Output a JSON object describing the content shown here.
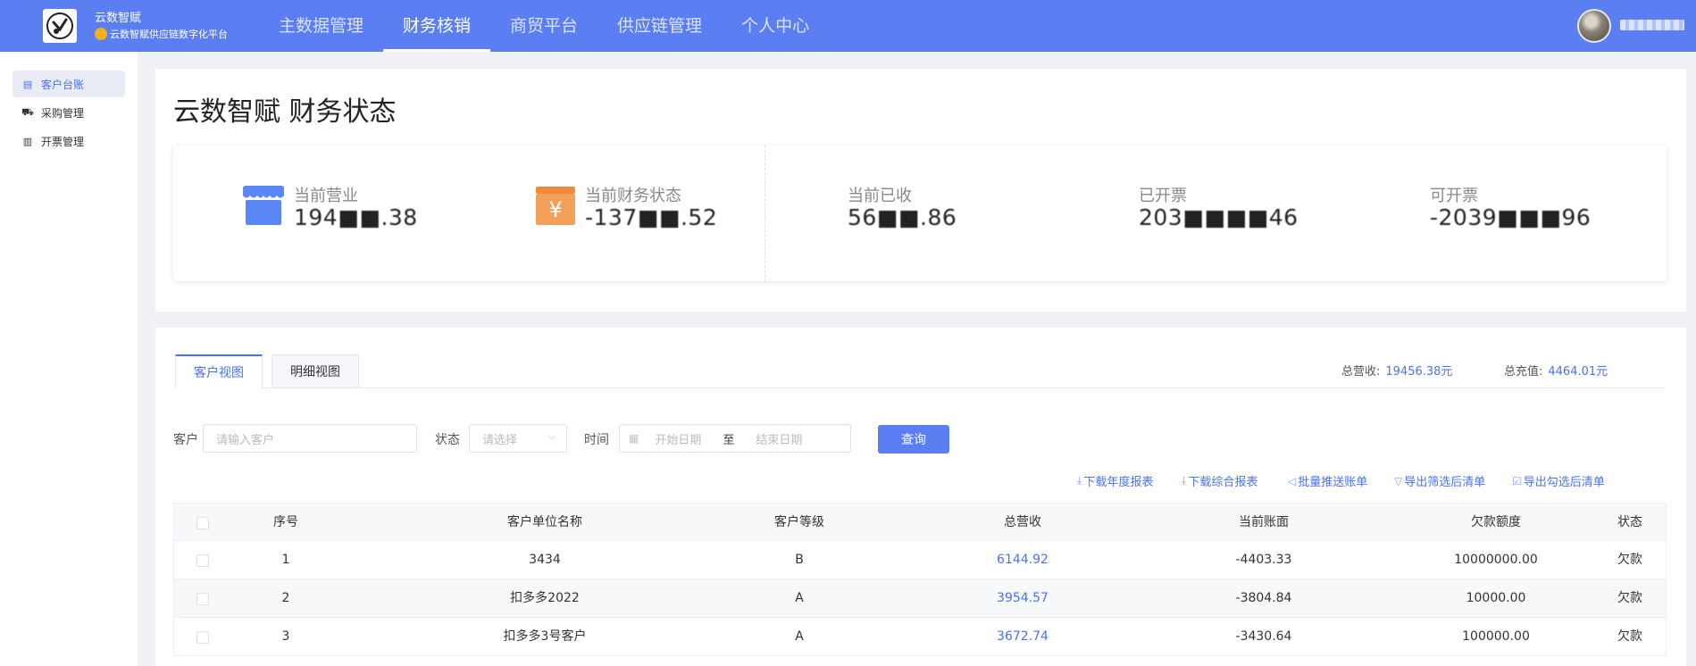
{
  "brand": {
    "title": "云数智赋",
    "subtitle": "云数智赋供应链数字化平台"
  },
  "nav": {
    "items": [
      {
        "label": "主数据管理"
      },
      {
        "label": "财务核销"
      },
      {
        "label": "商贸平台"
      },
      {
        "label": "供应链管理"
      },
      {
        "label": "个人中心"
      }
    ],
    "active_index": 1
  },
  "sidebar": {
    "items": [
      {
        "label": "客户台账",
        "icon": "ledger-icon"
      },
      {
        "label": "采购管理",
        "icon": "cart-icon"
      },
      {
        "label": "开票管理",
        "icon": "document-icon"
      }
    ],
    "active_index": 0
  },
  "page": {
    "title": "云数智赋 财务状态"
  },
  "stats": {
    "current_revenue": {
      "label": "当前营业",
      "value": "194■■.38",
      "icon": "store-icon"
    },
    "current_finance": {
      "label": "当前财务状态",
      "value": "-137■■.52",
      "icon": "yen-icon"
    },
    "received": {
      "label": "当前已收",
      "value": "56■■.86"
    },
    "invoiced": {
      "label": "已开票",
      "value": "203■■■■46"
    },
    "invoiceable": {
      "label": "可开票",
      "value": "-2039■■■96"
    }
  },
  "tabs": {
    "customer_view": "客户视图",
    "detail_view": "明细视图"
  },
  "totals": {
    "revenue_label": "总营收:",
    "revenue_value": "19456.38元",
    "recharge_label": "总充值:",
    "recharge_value": "4464.01元"
  },
  "filters": {
    "customer_label": "客户",
    "customer_placeholder": "请输入客户",
    "status_label": "状态",
    "status_placeholder": "请选择",
    "time_label": "时间",
    "start_placeholder": "开始日期",
    "range_sep": "至",
    "end_placeholder": "结束日期",
    "query_button": "查询"
  },
  "actions": {
    "download_annual": "下载年度报表",
    "download_summary": "下载综合报表",
    "batch_push": "批量推送账单",
    "export_filtered": "导出筛选后清单",
    "export_checked": "导出勾选后清单"
  },
  "table": {
    "headers": {
      "index": "序号",
      "name": "客户单位名称",
      "level": "客户等级",
      "revenue": "总营收",
      "balance": "当前账面",
      "limit": "欠款额度",
      "status": "状态"
    },
    "rows": [
      {
        "index": "1",
        "name": "3434",
        "level": "B",
        "revenue": "6144.92",
        "balance": "-4403.33",
        "limit": "10000000.00",
        "status": "欠款"
      },
      {
        "index": "2",
        "name": "扣多多2022",
        "level": "A",
        "revenue": "3954.57",
        "balance": "-3804.84",
        "limit": "10000.00",
        "status": "欠款"
      },
      {
        "index": "3",
        "name": "扣多多3号客户",
        "level": "A",
        "revenue": "3672.74",
        "balance": "-3430.64",
        "limit": "100000.00",
        "status": "欠款"
      }
    ]
  },
  "colors": {
    "primary": "#5b7ff2",
    "link": "#4a72f0",
    "store_icon": "#5b86f5",
    "yen_icon": "#f08a3a"
  }
}
